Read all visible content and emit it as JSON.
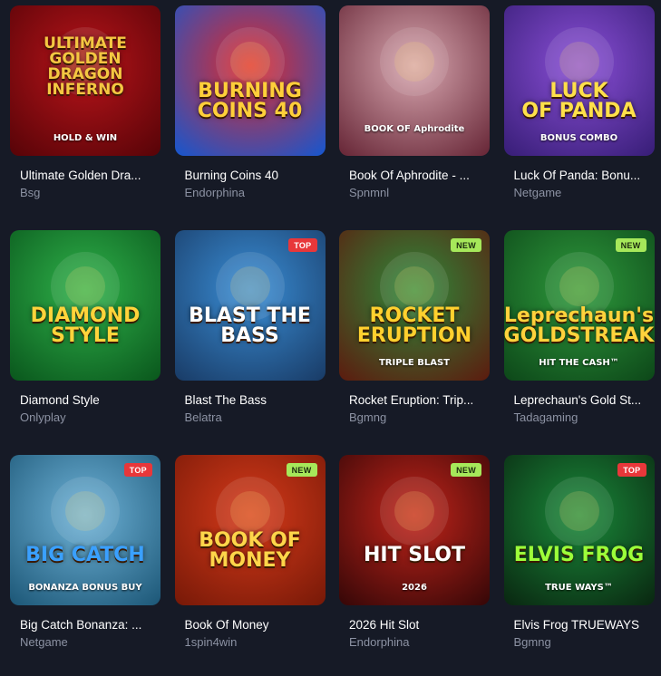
{
  "games": [
    {
      "title": "Ultimate Golden Dra...",
      "provider": "Bsg",
      "badge": "",
      "art": "ULTIMATE\nGOLDEN\nDRAGON\nINFERNO",
      "sub": "HOLD & WIN",
      "colors": [
        "#b8141a",
        "#5a0408"
      ],
      "text_color": "#f4c742",
      "icon": "dragon-icon"
    },
    {
      "title": "Burning Coins 40",
      "provider": "Endorphina",
      "badge": "",
      "art": "BURNING\nCOINS 40",
      "sub": "",
      "colors": [
        "#e02a2a",
        "#1d55c9"
      ],
      "text_color": "#ffcf3a",
      "icon": "flame-coin-icon"
    },
    {
      "title": "Book Of Aphrodite - ...",
      "provider": "Spnmnl",
      "badge": "",
      "art": "",
      "sub": "BOOK OF Aphrodite",
      "colors": [
        "#d8a7b0",
        "#6a2a3a"
      ],
      "text_color": "#fde7ea",
      "icon": "book-heart-icon"
    },
    {
      "title": "Luck Of Panda: Bonu...",
      "provider": "Netgame",
      "badge": "",
      "art": "LUCK\nOF PANDA",
      "sub": "BONUS COMBO",
      "colors": [
        "#8a4fd6",
        "#3a1f7a"
      ],
      "text_color": "#ffe04a",
      "icon": "panda-icon"
    },
    {
      "title": "Diamond Style",
      "provider": "Onlyplay",
      "badge": "",
      "art": "DIAMOND\nSTYLE",
      "sub": "",
      "colors": [
        "#2fb24a",
        "#0b5a1e"
      ],
      "text_color": "#ffd43b",
      "icon": "diamond-icon"
    },
    {
      "title": "Blast The Bass",
      "provider": "Belatra",
      "badge": "TOP",
      "art": "BLAST THE\nBASS",
      "sub": "",
      "colors": [
        "#3a8ed6",
        "#1a3e6a"
      ],
      "text_color": "#ffffff",
      "icon": "fisherman-icon"
    },
    {
      "title": "Rocket Eruption: Trip...",
      "provider": "Bgmng",
      "badge": "NEW",
      "art": "ROCKET\nERUPTION",
      "sub": "TRIPLE BLAST",
      "colors": [
        "#2f8a3a",
        "#5a1f10"
      ],
      "text_color": "#ffd02e",
      "icon": "volcano-icon"
    },
    {
      "title": "Leprechaun's Gold St...",
      "provider": "Tadagaming",
      "badge": "NEW",
      "art": "Leprechaun's\nGOLDSTREAK",
      "sub": "HIT THE CASH™",
      "colors": [
        "#2e9a3c",
        "#0e4a1a"
      ],
      "text_color": "#ffd23c",
      "icon": "leprechaun-icon"
    },
    {
      "title": "Big Catch Bonanza: ...",
      "provider": "Netgame",
      "badge": "TOP",
      "art": "BIG CATCH",
      "sub": "BONANZA BONUS BUY",
      "colors": [
        "#6fb3d8",
        "#1f5a7a"
      ],
      "text_color": "#3aa0ff",
      "icon": "fisherman-hat-icon"
    },
    {
      "title": "Book Of Money",
      "provider": "1spin4win",
      "badge": "NEW",
      "art": "BOOK OF\nMONEY",
      "sub": "",
      "colors": [
        "#d63a1a",
        "#7a1a08"
      ],
      "text_color": "#ffd54a",
      "icon": "money-book-icon"
    },
    {
      "title": "2026 Hit Slot",
      "provider": "Endorphina",
      "badge": "NEW",
      "art": "HIT SLOT",
      "sub": "2026",
      "colors": [
        "#c2241a",
        "#3a0808"
      ],
      "text_color": "#ffffff",
      "icon": "gem-icon"
    },
    {
      "title": "Elvis Frog TRUEWAYS",
      "provider": "Bgmng",
      "badge": "TOP",
      "art": "ELVIS FROG",
      "sub": "TRUE WAYS™",
      "colors": [
        "#1a8a3a",
        "#0a2a12"
      ],
      "text_color": "#9cff3a",
      "icon": "frog-icon"
    }
  ]
}
